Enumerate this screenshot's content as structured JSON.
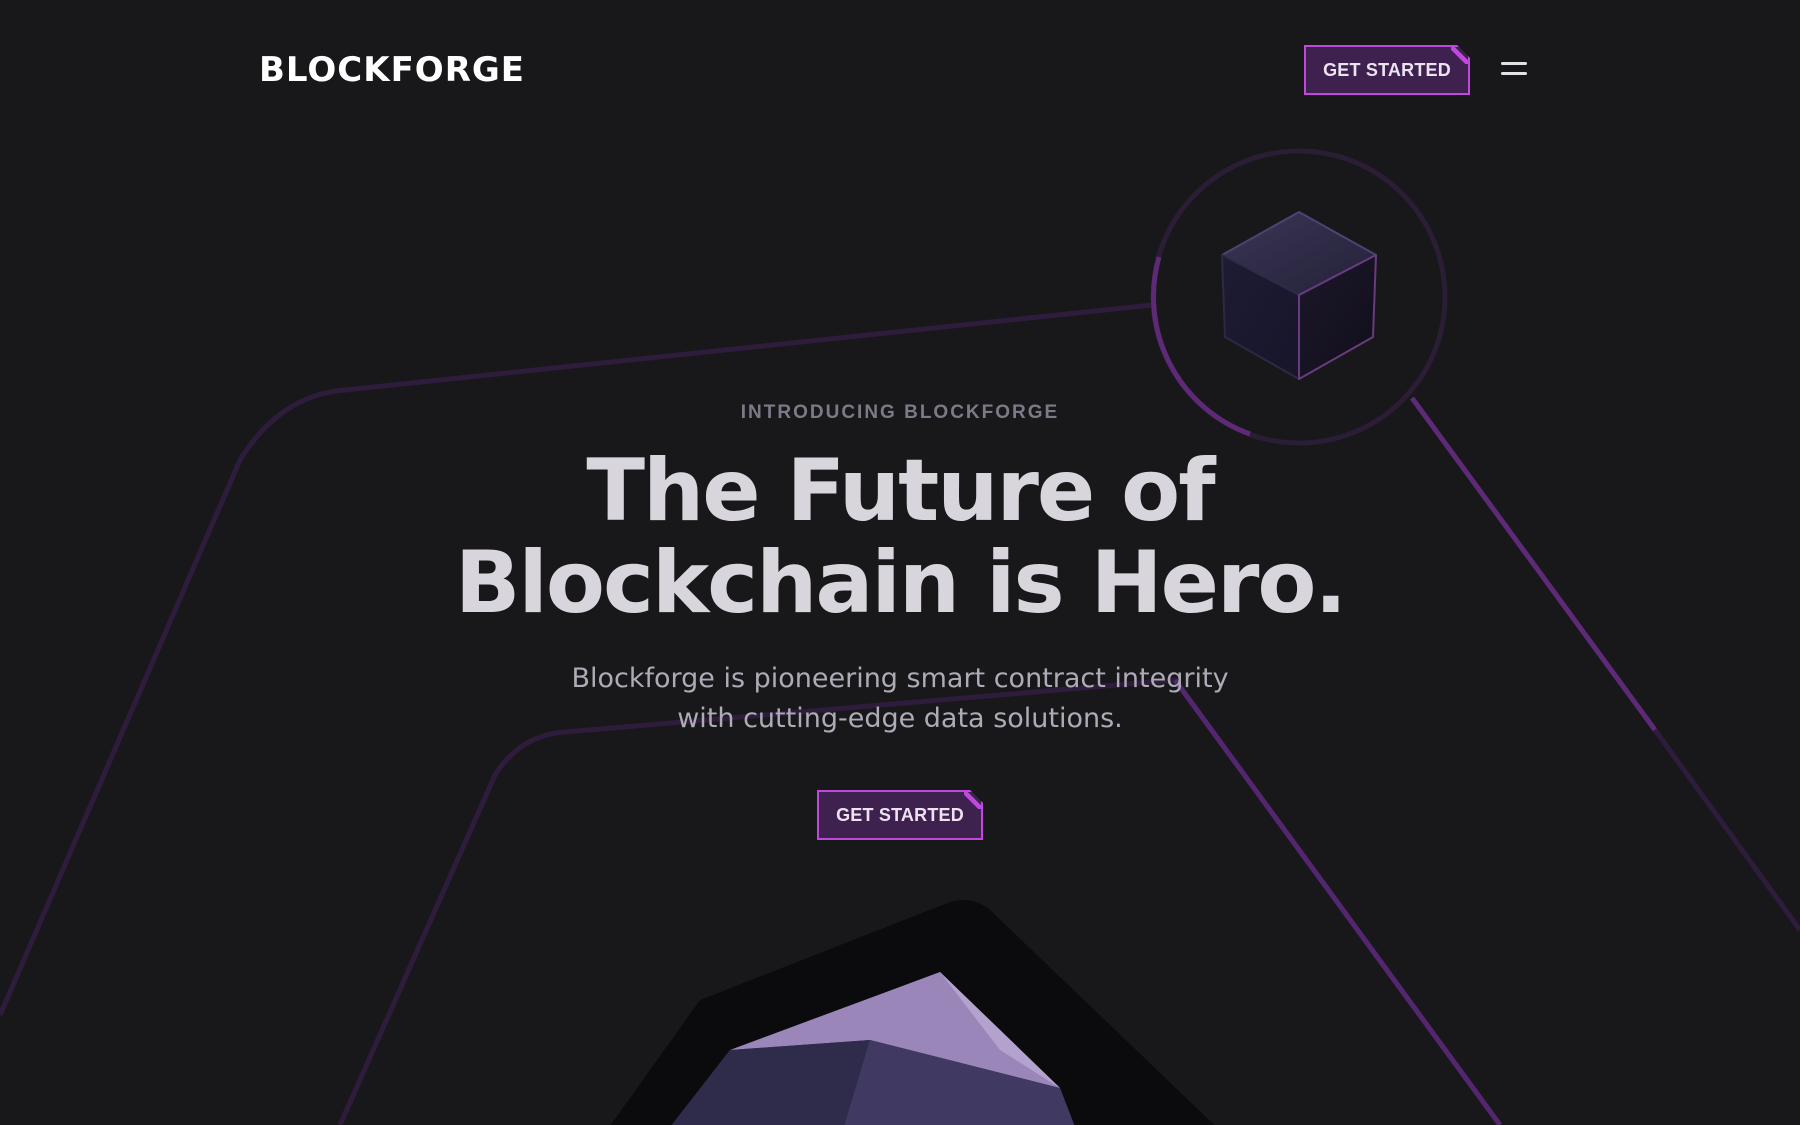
{
  "brand": {
    "name": "BLOCKFORGE"
  },
  "header": {
    "cta_label": "GET STARTED",
    "menu_icon": "hamburger-menu-icon"
  },
  "hero": {
    "eyebrow": "INTRODUCING BLOCKFORGE",
    "headline_line1": "The Future of",
    "headline_line2": "Blockchain is Hero.",
    "subtext_line1": "Blockforge is pioneering smart contract integrity",
    "subtext_line2": "with cutting-edge data solutions.",
    "cta_label": "GET STARTED"
  },
  "decor": {
    "top_image": "dark-cube-in-ring",
    "bottom_image": "purple-faceted-gem"
  },
  "colors": {
    "background": "#18181b",
    "accent": "#c048dc",
    "button_fill": "#3f2150",
    "line_dim": "#2e1c3c",
    "line_bright": "#5e2a78"
  }
}
